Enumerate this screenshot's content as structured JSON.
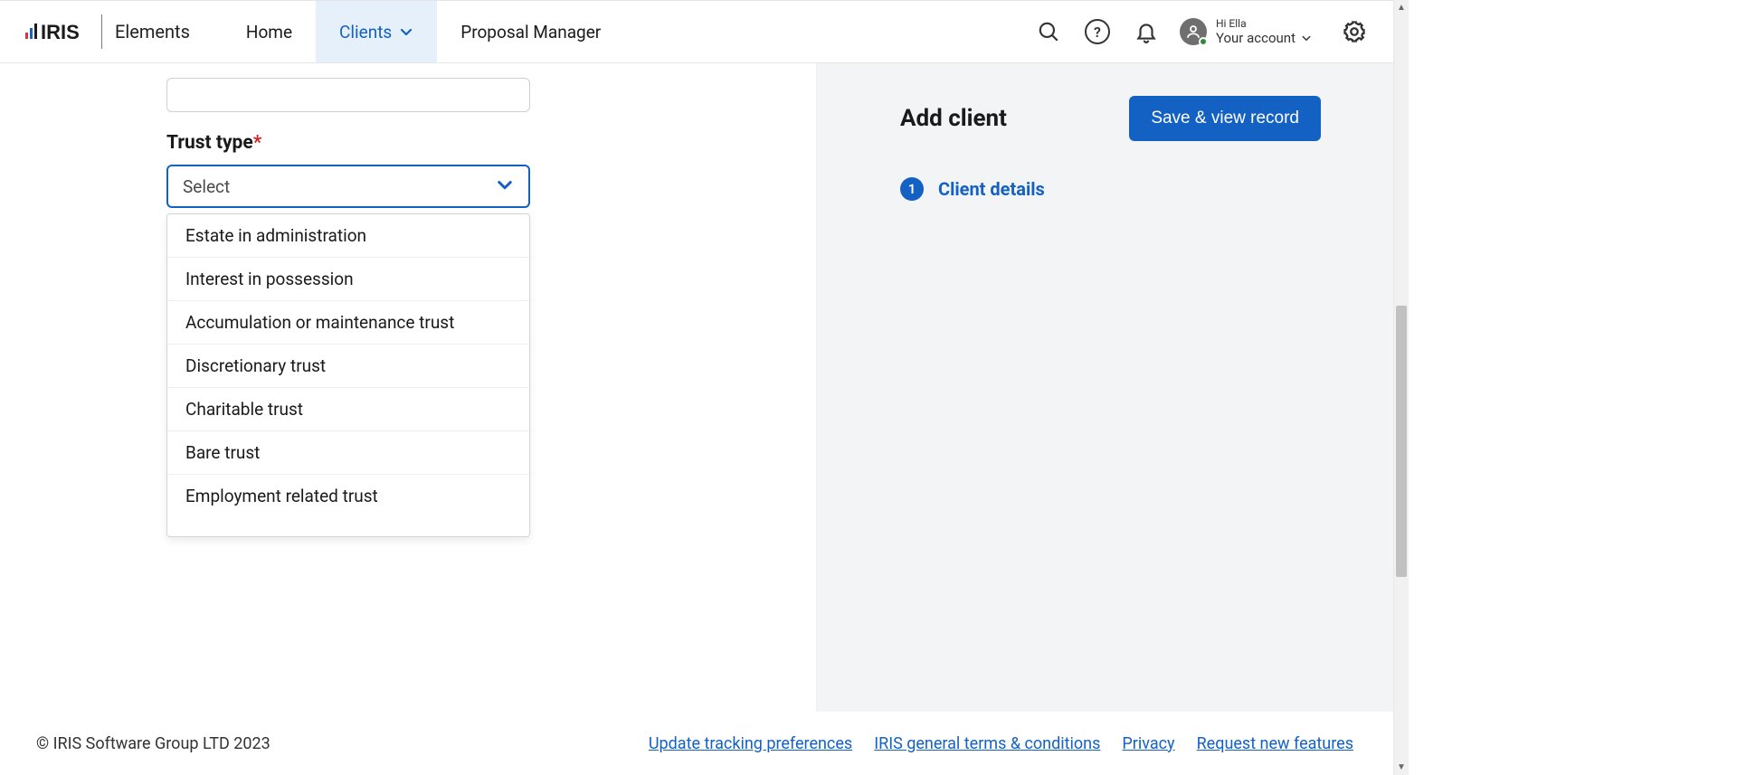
{
  "brand": {
    "suffix": "Elements"
  },
  "nav": {
    "home": "Home",
    "clients": "Clients",
    "proposal_manager": "Proposal Manager"
  },
  "account": {
    "greeting": "Hi Ella",
    "label": "Your account"
  },
  "form": {
    "trust_type_label": "Trust type",
    "select_placeholder": "Select",
    "options": [
      "Estate in administration",
      "Interest in possession",
      "Accumulation or maintenance trust",
      "Discretionary trust",
      "Charitable trust",
      "Bare trust",
      "Employment related trust"
    ]
  },
  "side": {
    "title": "Add client",
    "save_label": "Save & view record",
    "step_number": "1",
    "step_label": "Client details"
  },
  "footer": {
    "copyright": "© IRIS Software Group LTD 2023",
    "links": {
      "tracking": "Update tracking preferences",
      "terms": "IRIS general terms & conditions",
      "privacy": "Privacy",
      "request": "Request new features"
    }
  }
}
